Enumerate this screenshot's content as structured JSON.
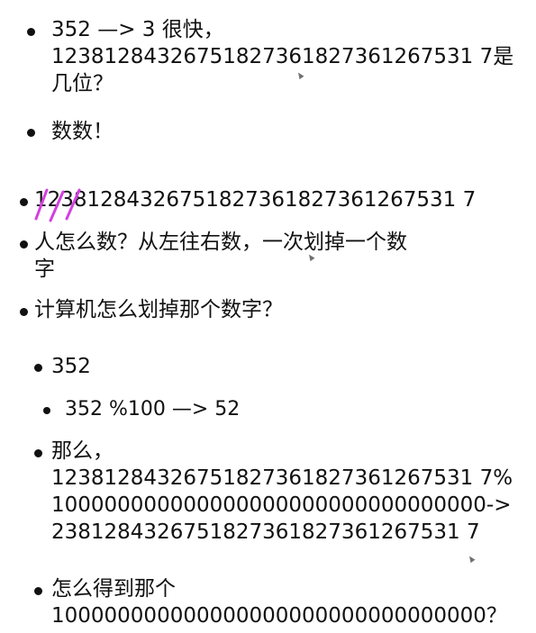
{
  "colors": {
    "text": "#111111",
    "background": "#ffffff",
    "annotation": "#d43fe0"
  },
  "slide": {
    "items": [
      {
        "lines": [
          "352 —> 3 很快，",
          "12381284326751827361827361267531 7是",
          "几位？"
        ]
      },
      {
        "lines": [
          "数数！"
        ]
      },
      {
        "lines": [
          "12381284326751827361827361267531 7"
        ]
      },
      {
        "lines": [
          "人怎么数？从左往右数，一次划掉一个数",
          "字"
        ]
      },
      {
        "lines": [
          "计算机怎么划掉那个数字？"
        ]
      },
      {
        "lines": [
          "352"
        ]
      },
      {
        "lines": [
          "352 %100 —> 52"
        ]
      },
      {
        "lines": [
          "那么，",
          "12381284326751827361827361267531 7%",
          "100000000000000000000000000000000->",
          "2381284326751827361827361267531 7"
        ]
      },
      {
        "lines": [
          "怎么得到那个",
          "100000000000000000000000000000000？"
        ]
      }
    ]
  }
}
